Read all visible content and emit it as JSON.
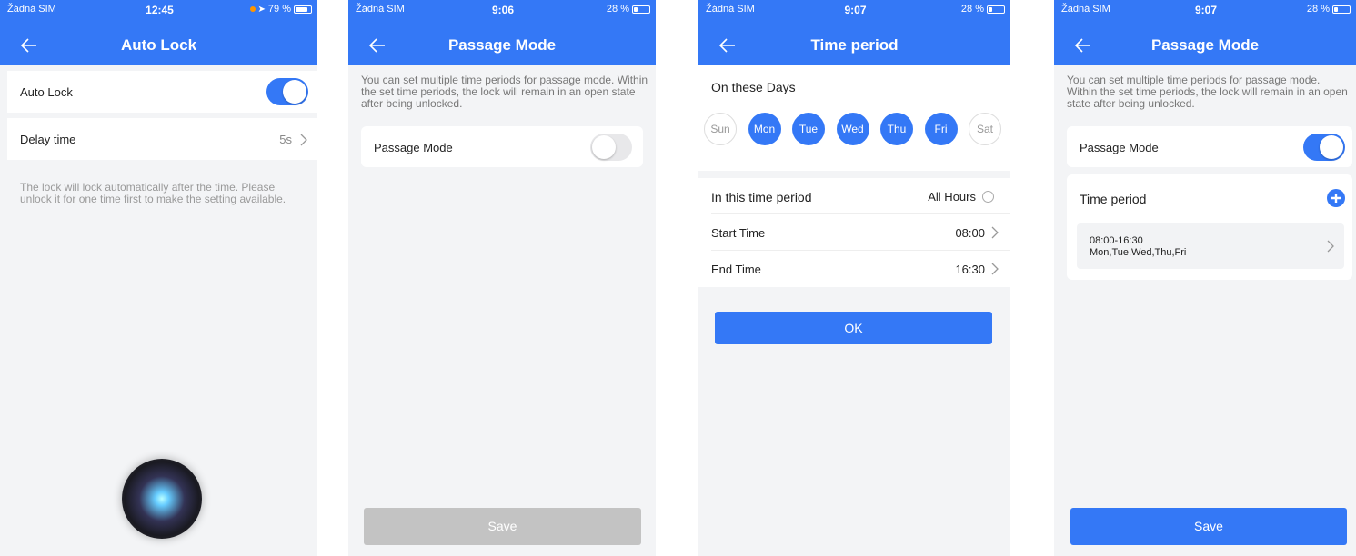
{
  "status": {
    "s1": {
      "carrier": "Žádná SIM",
      "time": "12:45",
      "battery": "79 %",
      "level": 0.79
    },
    "s2": {
      "carrier": "Žádná SIM",
      "time": "9:06",
      "battery": "28 %",
      "level": 0.28
    },
    "s3": {
      "carrier": "Žádná SIM",
      "time": "9:07",
      "battery": "28 %",
      "level": 0.28
    },
    "s4": {
      "carrier": "Žádná SIM",
      "time": "9:07",
      "battery": "28 %",
      "level": 0.28
    }
  },
  "icons": {
    "back": "back-arrow-icon",
    "wifi": "wifi-icon",
    "battery": "battery-icon",
    "chevron": "chevron-right-icon",
    "add": "add-circle-icon",
    "radio": "radio-icon",
    "siri": "siri-orb-icon"
  },
  "colors": {
    "accent": "#3478f6",
    "disabled": "#c3c3c3"
  },
  "screen1": {
    "title": "Auto Lock",
    "auto_lock_label": "Auto Lock",
    "auto_lock_on": true,
    "delay_label": "Delay time",
    "delay_value": "5s",
    "description": "The lock will lock automatically after the time. Please unlock it for one time first to make the setting available."
  },
  "screen2": {
    "title": "Passage Mode",
    "description": "You can set multiple time periods for passage mode. Within the set time periods, the lock will remain in an open state after being unlocked.",
    "passage_label": "Passage Mode",
    "passage_on": false,
    "save_label": "Save"
  },
  "screen3": {
    "title": "Time period",
    "days_heading": "On these Days",
    "days": [
      {
        "label": "Sun",
        "selected": false
      },
      {
        "label": "Mon",
        "selected": true
      },
      {
        "label": "Tue",
        "selected": true
      },
      {
        "label": "Wed",
        "selected": true
      },
      {
        "label": "Thu",
        "selected": true
      },
      {
        "label": "Fri",
        "selected": true
      },
      {
        "label": "Sat",
        "selected": false
      }
    ],
    "period_label": "In this time period",
    "all_hours_label": "All Hours",
    "start_label": "Start Time",
    "start_value": "08:00",
    "end_label": "End Time",
    "end_value": "16:30",
    "ok_label": "OK"
  },
  "screen4": {
    "title": "Passage Mode",
    "description": "You can set multiple time periods for passage mode. Within the set time periods, the lock will remain in an open state after being unlocked.",
    "passage_label": "Passage Mode",
    "passage_on": true,
    "time_period_label": "Time period",
    "period_time": "08:00-16:30",
    "period_days": "Mon,Tue,Wed,Thu,Fri",
    "save_label": "Save"
  }
}
